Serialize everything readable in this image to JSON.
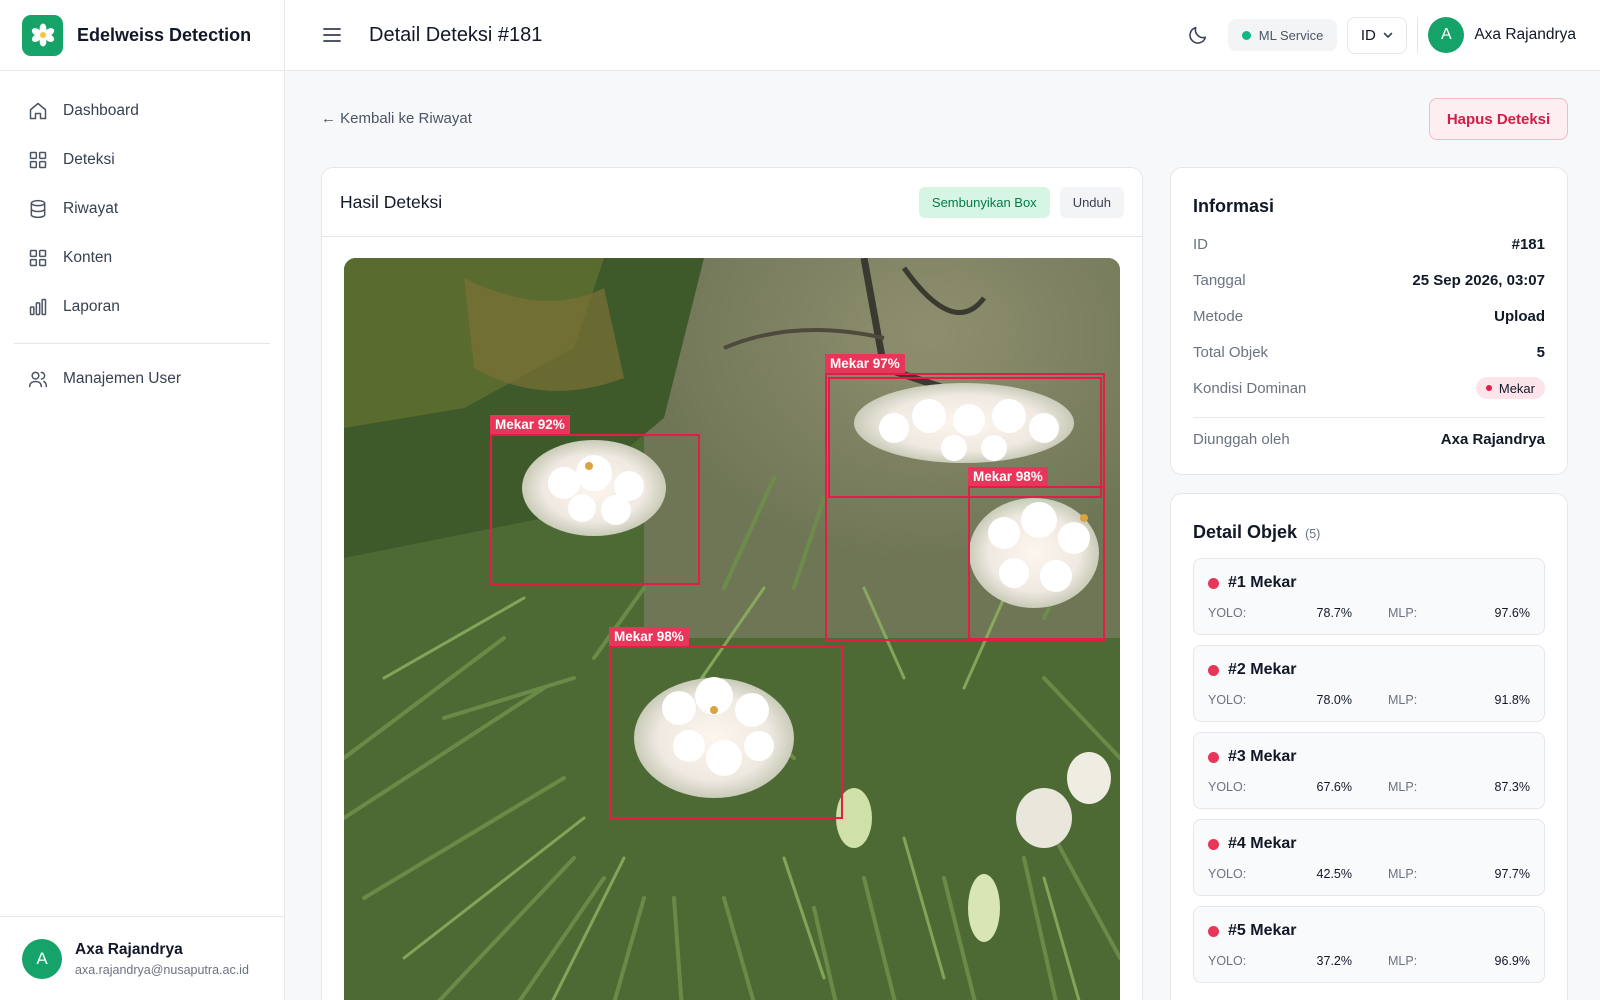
{
  "app": {
    "name": "Edelweiss Detection"
  },
  "nav": {
    "items": [
      {
        "label": "Dashboard",
        "icon": "home-icon"
      },
      {
        "label": "Deteksi",
        "icon": "grid-icon"
      },
      {
        "label": "Riwayat",
        "icon": "database-icon"
      },
      {
        "label": "Konten",
        "icon": "grid-icon"
      },
      {
        "label": "Laporan",
        "icon": "bar-chart-icon"
      }
    ],
    "admin": {
      "label": "Manajemen User",
      "icon": "users-icon"
    }
  },
  "user": {
    "initial": "A",
    "name": "Axa Rajandrya",
    "email": "axa.rajandrya@nusaputra.ac.id"
  },
  "header": {
    "title": "Detail Deteksi #181",
    "ml_service": "ML Service",
    "language": "ID",
    "user_name": "Axa Rajandrya"
  },
  "actions": {
    "back": "← Kembali ke Riwayat",
    "delete": "Hapus Deteksi"
  },
  "result": {
    "title": "Hasil Deteksi",
    "hide_boxes": "Sembunyikan Box",
    "download": "Unduh",
    "boxes": [
      {
        "label": "Mekar 92%"
      },
      {
        "label": "Mekar 97%"
      },
      {
        "label": "Mekar 98%"
      },
      {
        "label": "Mekar 98%"
      }
    ]
  },
  "info": {
    "title": "Informasi",
    "rows": [
      {
        "key": "ID",
        "value": "#181"
      },
      {
        "key": "Tanggal",
        "value": "25 Sep 2026, 03:07"
      },
      {
        "key": "Metode",
        "value": "Upload"
      },
      {
        "key": "Total Objek",
        "value": "5"
      },
      {
        "key": "Kondisi Dominan",
        "value": "Mekar"
      },
      {
        "key": "Diunggah oleh",
        "value": "Axa Rajandrya"
      }
    ]
  },
  "objects": {
    "title": "Detail Objek",
    "count": "(5)",
    "yolo_label": "YOLO:",
    "mlp_label": "MLP:",
    "items": [
      {
        "name": "#1 Mekar",
        "yolo": "78.7%",
        "mlp": "97.6%"
      },
      {
        "name": "#2 Mekar",
        "yolo": "78.0%",
        "mlp": "91.8%"
      },
      {
        "name": "#3 Mekar",
        "yolo": "67.6%",
        "mlp": "87.3%"
      },
      {
        "name": "#4 Mekar",
        "yolo": "42.5%",
        "mlp": "97.7%"
      },
      {
        "name": "#5 Mekar",
        "yolo": "37.2%",
        "mlp": "96.9%"
      }
    ]
  },
  "colors": {
    "brand": "#16a36a",
    "danger": "#e11d48",
    "success_bg": "#d6f5e5"
  }
}
